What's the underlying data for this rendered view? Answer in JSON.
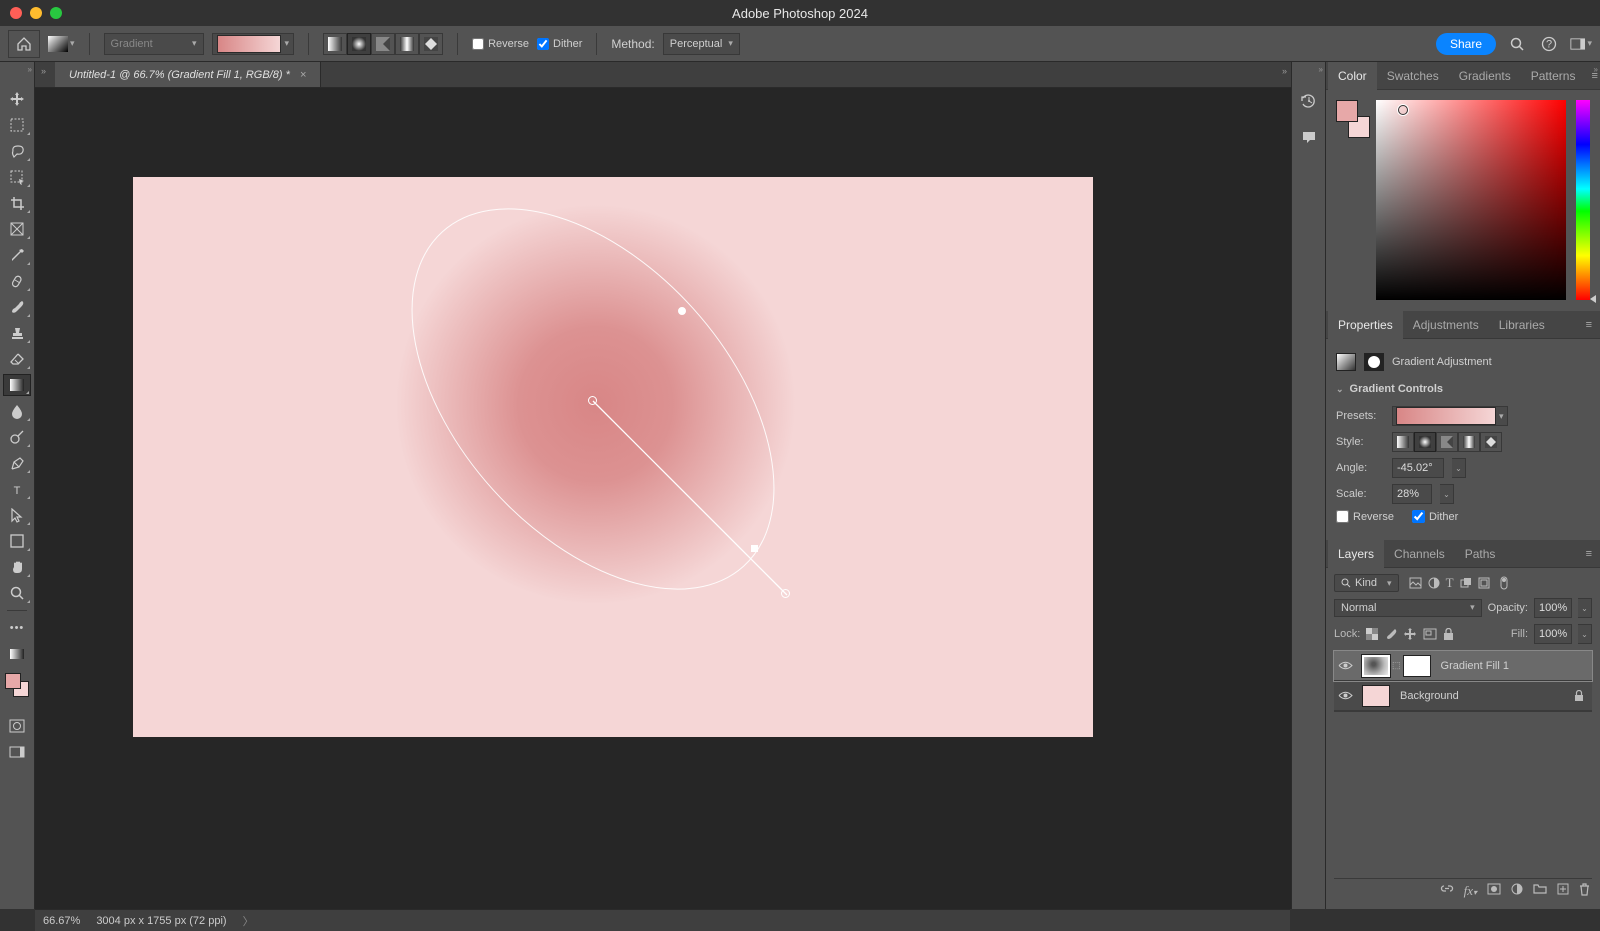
{
  "app": {
    "title": "Adobe Photoshop 2024"
  },
  "options": {
    "tool_label": "Gradient",
    "reverse_label": "Reverse",
    "reverse_checked": false,
    "dither_label": "Dither",
    "dither_checked": true,
    "method_label": "Method:",
    "method_value": "Perceptual",
    "share_label": "Share"
  },
  "document": {
    "tab_title": "Untitled-1 @ 66.7% (Gradient Fill 1, RGB/8) *"
  },
  "status": {
    "zoom": "66.67%",
    "doc_info": "3004 px x 1755 px (72 ppi)"
  },
  "panels": {
    "color": {
      "tab": "Color",
      "swatches": "Swatches",
      "gradients": "Gradients",
      "patterns": "Patterns"
    },
    "properties": {
      "tab": "Properties",
      "adjustments": "Adjustments",
      "libraries": "Libraries",
      "type_label": "Gradient Adjustment",
      "section": "Gradient Controls",
      "presets_label": "Presets:",
      "style_label": "Style:",
      "angle_label": "Angle:",
      "angle_value": "-45.02°",
      "scale_label": "Scale:",
      "scale_value": "28%",
      "reverse_label": "Reverse",
      "reverse_checked": false,
      "dither_label": "Dither",
      "dither_checked": true
    },
    "layers": {
      "tab": "Layers",
      "channels": "Channels",
      "paths": "Paths",
      "kind": "Kind",
      "blend_mode": "Normal",
      "opacity_label": "Opacity:",
      "opacity_value": "100%",
      "lock_label": "Lock:",
      "fill_label": "Fill:",
      "fill_value": "100%",
      "items": [
        {
          "name": "Gradient Fill 1",
          "locked": false,
          "active": true
        },
        {
          "name": "Background",
          "locked": true,
          "active": false
        }
      ]
    }
  },
  "colors": {
    "foreground": "#e7a8a8",
    "background_swatch": "#f5d6d6",
    "canvas_bg": "#f5d6d6",
    "gradient_inner": "#d88686"
  }
}
